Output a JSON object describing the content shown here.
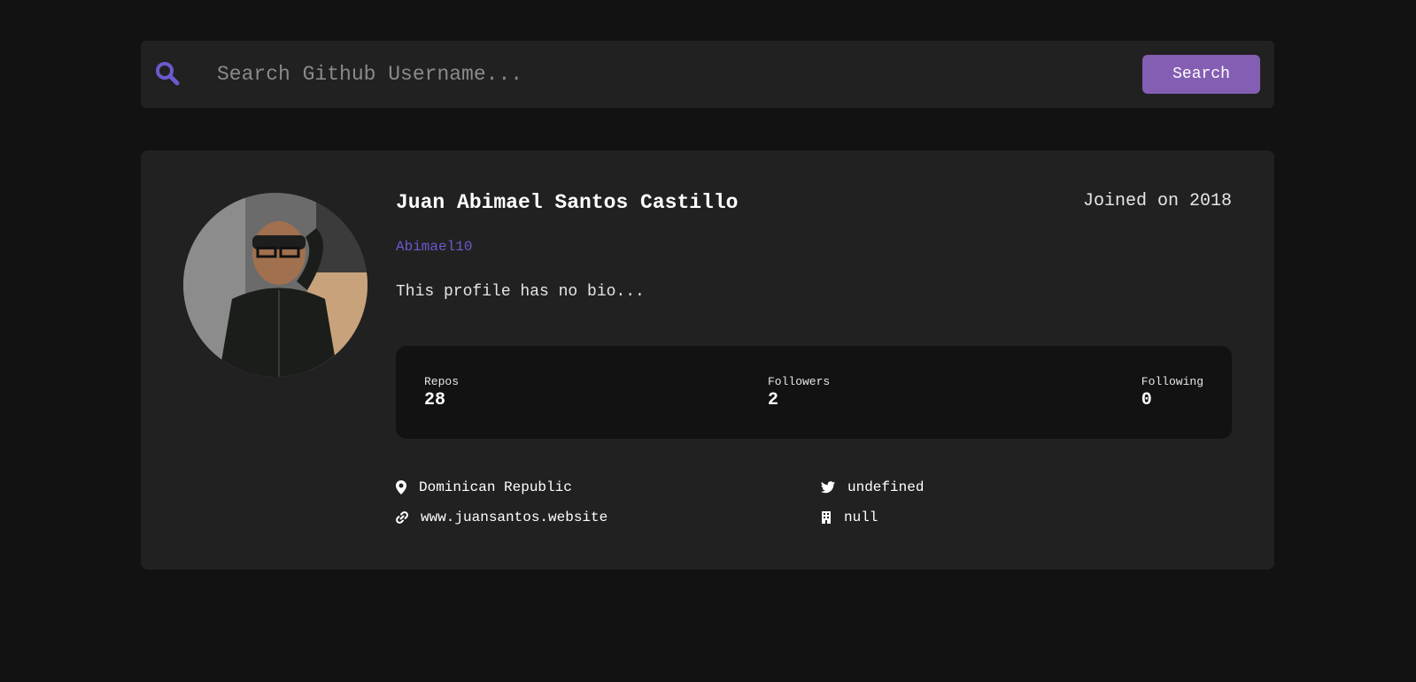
{
  "search": {
    "placeholder": "Search Github Username...",
    "button_label": "Search",
    "icon": "search-icon",
    "accent_color": "#6a5acd",
    "button_color": "#845eb3"
  },
  "profile": {
    "name": "Juan Abimael Santos Castillo",
    "joined": "Joined on 2018",
    "login": "Abimael10",
    "bio": "This profile has no bio...",
    "stats": [
      {
        "label": "Repos",
        "value": "28"
      },
      {
        "label": "Followers",
        "value": "2"
      },
      {
        "label": "Following",
        "value": "0"
      }
    ],
    "links": {
      "location": {
        "icon": "location-pin-icon",
        "text": "Dominican Republic"
      },
      "website": {
        "icon": "link-icon",
        "text": "www.juansantos.website"
      },
      "twitter": {
        "icon": "twitter-icon",
        "text": "undefined"
      },
      "company": {
        "icon": "building-icon",
        "text": "null"
      }
    }
  },
  "colors": {
    "background": "#121212",
    "card": "#212121",
    "stats_background": "#121212",
    "text": "#ffffff"
  }
}
